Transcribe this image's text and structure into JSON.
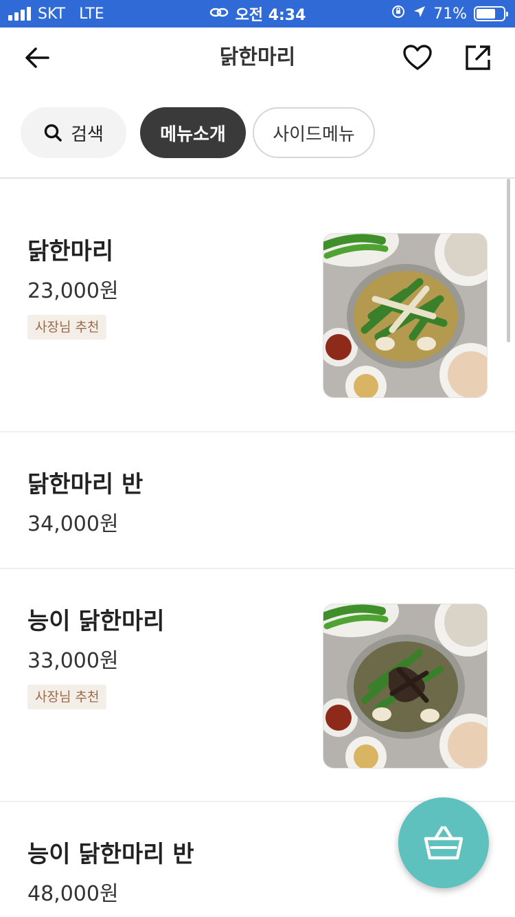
{
  "status_bar": {
    "carrier": "SKT",
    "network": "LTE",
    "time": "오전 4:34",
    "battery": "71%",
    "battery_level": 0.71
  },
  "header": {
    "title": "닭한마리",
    "icons": [
      "back-arrow-icon",
      "heart-icon",
      "share-icon"
    ]
  },
  "tabs": [
    {
      "label": "검색",
      "icon": "search-icon"
    },
    {
      "label": "메뉴소개",
      "selected": true
    },
    {
      "label": "사이드메뉴"
    }
  ],
  "menu": [
    {
      "name": "닭한마리",
      "price": "23,000원",
      "badge": "사장님 추천",
      "has_photo": true
    },
    {
      "name": "닭한마리 반",
      "price": "34,000원",
      "has_photo": false
    },
    {
      "name": "능이 닭한마리",
      "price": "33,000원",
      "badge": "사장님 추천",
      "has_photo": true
    },
    {
      "name": "능이 닭한마리 반",
      "price": "48,000원",
      "has_photo": false
    }
  ],
  "colors": {
    "status_bar": "#2f6ad6",
    "active_chip": "#3a3a3a",
    "badge_bg": "#f4eee8",
    "badge_text": "#9b6a47",
    "cart_fab": "#5ec1bd"
  },
  "fab": {
    "icon": "shopping-basket-icon"
  }
}
